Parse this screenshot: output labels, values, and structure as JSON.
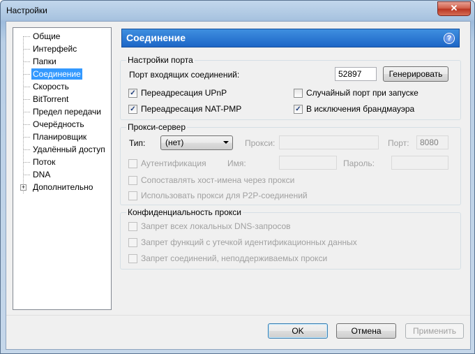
{
  "window": {
    "title": "Настройки",
    "close": "✕"
  },
  "sidebar": {
    "items": [
      {
        "label": "Общие"
      },
      {
        "label": "Интерфейс"
      },
      {
        "label": "Папки"
      },
      {
        "label": "Соединение",
        "selected": true
      },
      {
        "label": "Скорость"
      },
      {
        "label": "BitTorrent"
      },
      {
        "label": "Предел передачи"
      },
      {
        "label": "Очерёдность"
      },
      {
        "label": "Планировщик"
      },
      {
        "label": "Удалённый доступ"
      },
      {
        "label": "Поток"
      },
      {
        "label": "DNA"
      },
      {
        "label": "Дополнительно",
        "expandable": true,
        "expander": "+"
      }
    ]
  },
  "header": {
    "title": "Соединение",
    "help_icon": "?"
  },
  "port_settings": {
    "legend": "Настройки порта",
    "incoming_port_label": "Порт входящих соединений:",
    "incoming_port_value": "52897",
    "generate_button": "Генерировать",
    "upnp": {
      "label": "Переадресация UPnP",
      "checked": true
    },
    "natpmp": {
      "label": "Переадресация NAT-PMP",
      "checked": true
    },
    "random_port": {
      "label": "Случайный порт при запуске",
      "checked": false
    },
    "firewall": {
      "label": "В исключения брандмауэра",
      "checked": true
    }
  },
  "proxy": {
    "legend": "Прокси-сервер",
    "type_label": "Тип:",
    "type_value": "(нет)",
    "proxy_label": "Прокси:",
    "proxy_value": "",
    "port_label": "Порт:",
    "port_value": "8080",
    "auth": {
      "label": "Аутентификация",
      "checked": false
    },
    "name_label": "Имя:",
    "name_value": "",
    "password_label": "Пароль:",
    "password_value": "",
    "resolve_hostnames": {
      "label": "Сопоставлять хост-имена через прокси",
      "checked": false
    },
    "p2p": {
      "label": "Использовать прокси для P2P-соединений",
      "checked": false
    }
  },
  "privacy": {
    "legend": "Конфиденциальность прокси",
    "dns": {
      "label": "Запрет всех локальных DNS-запросов",
      "checked": false
    },
    "leak": {
      "label": "Запрет функций с утечкой идентификационных данных",
      "checked": false
    },
    "unsupported": {
      "label": "Запрет соединений, неподдерживаемых прокси",
      "checked": false
    }
  },
  "footer": {
    "ok": "OK",
    "cancel": "Отмена",
    "apply": "Применить"
  },
  "check_mark": "✓"
}
